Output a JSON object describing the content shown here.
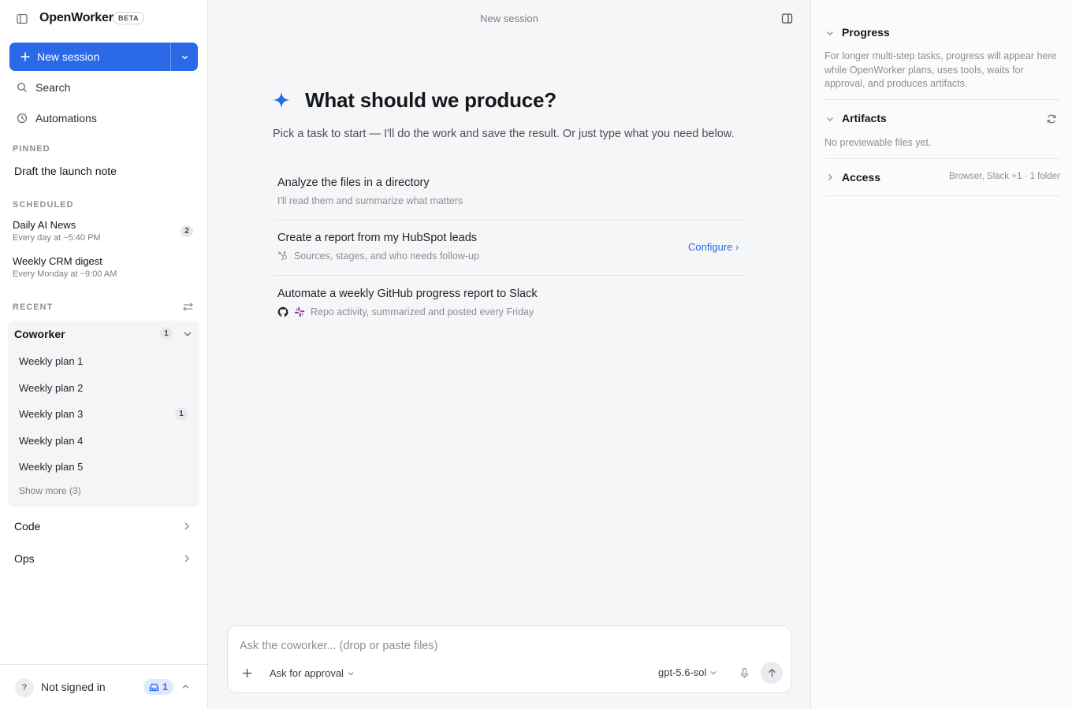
{
  "app": {
    "name": "OpenWorker",
    "badge": "BETA"
  },
  "sidebar": {
    "new_session_label": "New session",
    "search_label": "Search",
    "automations_label": "Automations",
    "pinned": {
      "heading": "PINNED",
      "items": [
        {
          "label": "Draft the launch note"
        }
      ]
    },
    "scheduled": {
      "heading": "SCHEDULED",
      "items": [
        {
          "title": "Daily AI News",
          "schedule": "Every day at ~5:40 PM",
          "count": "2"
        },
        {
          "title": "Weekly CRM digest",
          "schedule": "Every Monday at ~9:00 AM"
        }
      ]
    },
    "recent": {
      "heading": "RECENT",
      "groups": [
        {
          "label": "Coworker",
          "count": "1",
          "expanded": true,
          "items": [
            {
              "label": "Weekly plan 1"
            },
            {
              "label": "Weekly plan 2"
            },
            {
              "label": "Weekly plan 3",
              "count": "1"
            },
            {
              "label": "Weekly plan 4"
            },
            {
              "label": "Weekly plan 5"
            }
          ],
          "show_more": "Show more (3)"
        },
        {
          "label": "Code",
          "expanded": false
        },
        {
          "label": "Ops",
          "expanded": false
        }
      ]
    },
    "footer": {
      "help": "?",
      "account_status": "Not signed in",
      "inbox_count": "1"
    }
  },
  "main": {
    "session_title": "New session",
    "hero_title": "What should we produce?",
    "hero_subtitle": "Pick a task to start — I'll do the work and save the result. Or just type what you need below.",
    "tasks": [
      {
        "title": "Analyze the files in a directory",
        "subtitle": "I'll read them and summarize what matters",
        "icons": []
      },
      {
        "title": "Create a report from my HubSpot leads",
        "subtitle": "Sources, stages, and who needs follow-up",
        "icons": [
          "hubspot-icon"
        ],
        "action": "Configure ›"
      },
      {
        "title": "Automate a weekly GitHub progress report to Slack",
        "subtitle": "Repo activity, summarized and posted every Friday",
        "icons": [
          "github-icon",
          "slack-icon"
        ]
      }
    ],
    "composer": {
      "placeholder": "Ask the coworker...  (drop or paste files)",
      "mode": "Ask for approval",
      "model": "gpt-5.6-sol"
    }
  },
  "right_panel": {
    "progress": {
      "title": "Progress",
      "body": "For longer multi-step tasks, progress will appear here while OpenWorker plans, uses tools, waits for approval, and produces artifacts."
    },
    "artifacts": {
      "title": "Artifacts",
      "body": "No previewable files yet."
    },
    "access": {
      "title": "Access",
      "summary": "Browser, Slack +1 · 1 folder"
    }
  },
  "colors": {
    "accent": "#2b6ae6",
    "sidebar_bg": "#ffffff",
    "main_bg": "#f5f6f7",
    "panel_bg": "#fbfbfc"
  }
}
